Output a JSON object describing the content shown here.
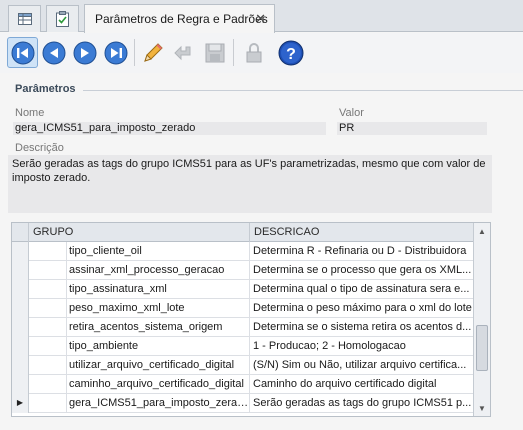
{
  "tabs": {
    "main_label": "Parâmetros de Regra e Padrões",
    "close_glyph": "✕"
  },
  "toolbar": {
    "buttons": [
      "first-record",
      "previous-record",
      "next-record",
      "last-record",
      "edit",
      "undo",
      "save",
      "lock",
      "help"
    ]
  },
  "params": {
    "section_title": "Parâmetros",
    "name_label": "Nome",
    "name_value": "gera_ICMS51_para_imposto_zerado",
    "value_label": "Valor",
    "value_value": "PR",
    "desc_label": "Descrição",
    "desc_value": "Serão geradas as tags do grupo ICMS51 para as UF's parametrizadas, mesmo que com valor de imposto zerado."
  },
  "grid": {
    "col_group": "GRUPO",
    "col_desc": "DESCRICAO",
    "rows": [
      {
        "name": "tipo_cliente_oil",
        "desc": "Determina R - Refinaria ou D - Distribuidora"
      },
      {
        "name": "assinar_xml_processo_geracao",
        "desc": "Determina se o processo que gera os XML..."
      },
      {
        "name": "tipo_assinatura_xml",
        "desc": "Determina qual o tipo de assinatura sera e..."
      },
      {
        "name": "peso_maximo_xml_lote",
        "desc": "Determina o peso máximo para o xml do lote"
      },
      {
        "name": "retira_acentos_sistema_origem",
        "desc": "Determina se o sistema retira os acentos d..."
      },
      {
        "name": "tipo_ambiente",
        "desc": "1 - Producao; 2 - Homologacao"
      },
      {
        "name": "utilizar_arquivo_certificado_digital",
        "desc": "(S/N) Sim ou Não, utilizar arquivo certifica..."
      },
      {
        "name": "caminho_arquivo_certificado_digital",
        "desc": "Caminho do arquivo certificado digital"
      },
      {
        "name": "gera_ICMS51_para_imposto_zerado",
        "desc": "Serão geradas as tags do grupo ICMS51 p..."
      }
    ],
    "current_row_indicator": "▶"
  },
  "colors": {
    "accent_blue": "#2f6fc0",
    "help_blue": "#1e4fb5"
  }
}
